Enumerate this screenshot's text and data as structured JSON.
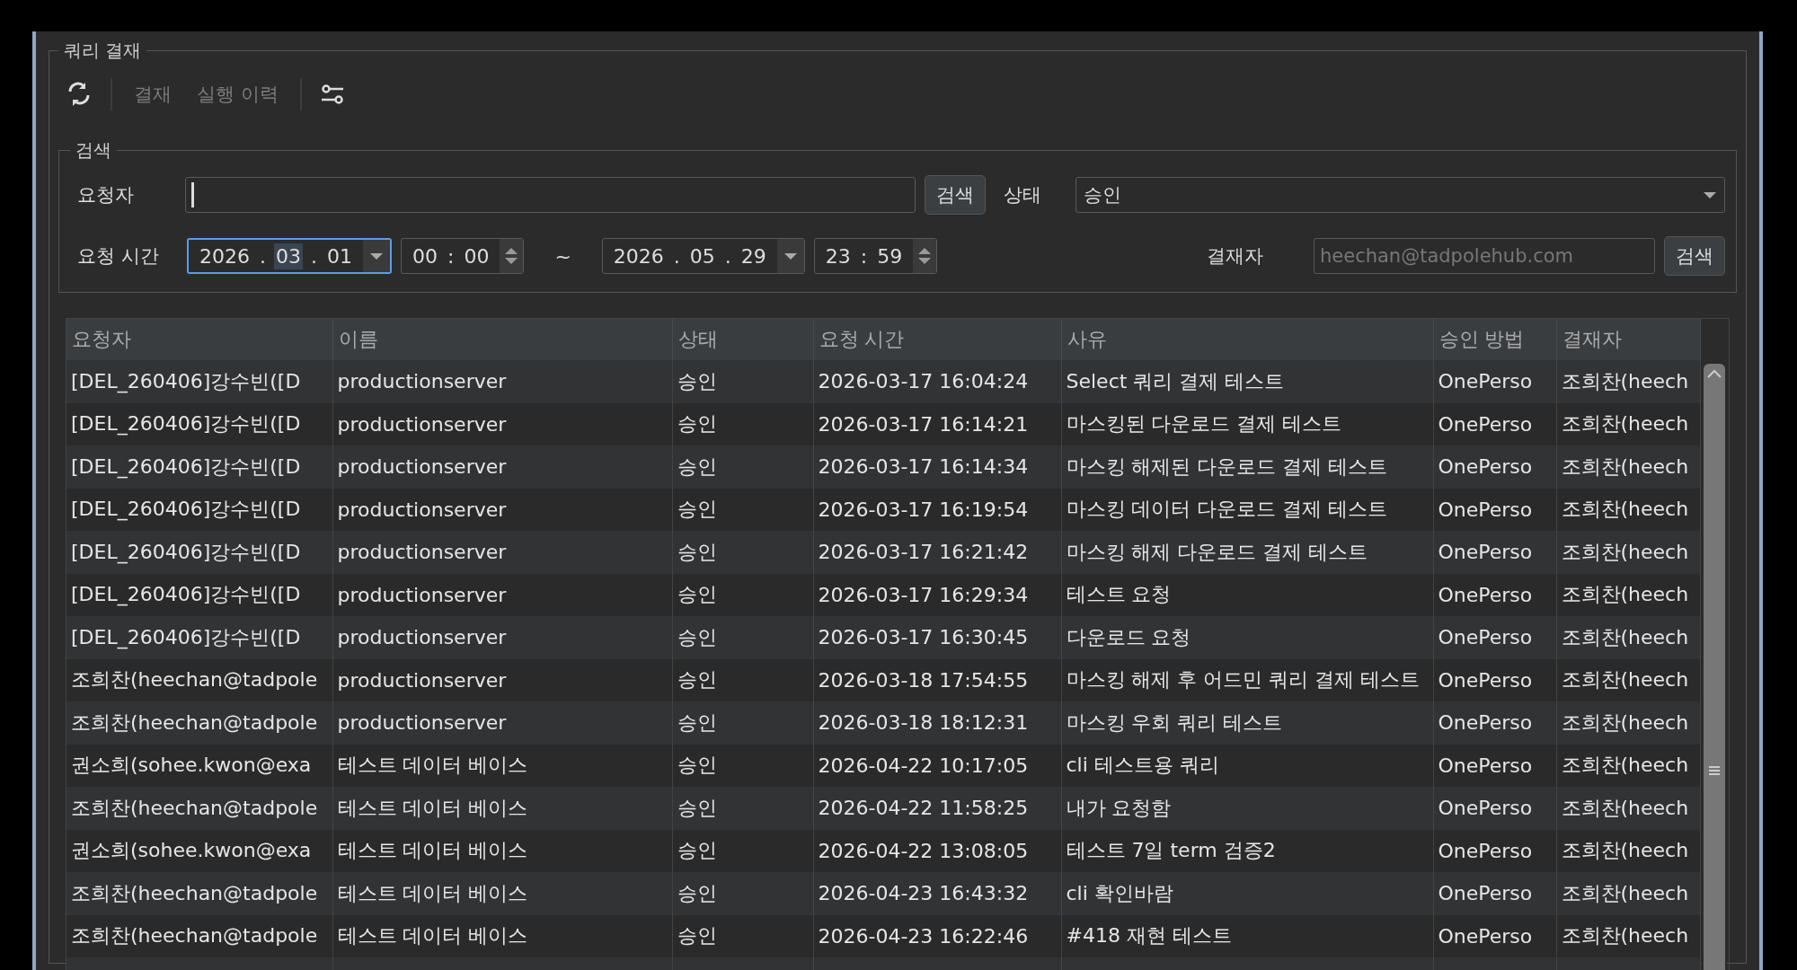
{
  "panel": {
    "title": "쿼리 결재"
  },
  "toolbar": [
    {
      "kind": "icon"
    },
    {
      "kind": "divider"
    },
    {
      "kind": "text",
      "label": "결재",
      "disabled": true
    },
    {
      "kind": "text",
      "label": "실행 이력",
      "disabled": true
    },
    {
      "kind": "divider"
    },
    {
      "kind": "icon"
    }
  ],
  "search": {
    "title": "검색",
    "requester": {
      "label": "요청자",
      "focused": true,
      "button": "검색"
    },
    "status": {
      "label": "상태",
      "value": "승인"
    },
    "time": {
      "label": "요청 시간",
      "separator_range": "~",
      "start_date": {
        "parts": [
          {
            "text": "2026",
            "selected": false
          },
          {
            "text": "03",
            "selected": true
          },
          {
            "text": "01",
            "selected": false
          }
        ],
        "separator": ".",
        "focused": true
      },
      "start_time": {
        "parts": [
          {
            "text": "00",
            "selected": false
          },
          {
            "text": "00",
            "selected": false
          }
        ],
        "separator": ":"
      },
      "end_date": {
        "parts": [
          {
            "text": "2026",
            "selected": false
          },
          {
            "text": "05",
            "selected": false
          },
          {
            "text": "29",
            "selected": false
          }
        ],
        "separator": ".",
        "focused": false
      },
      "end_time": {
        "parts": [
          {
            "text": "23",
            "selected": false
          },
          {
            "text": "59",
            "selected": false
          }
        ],
        "separator": ":"
      }
    },
    "approver": {
      "label": "결재자",
      "placeholder": "heechan@tadpolehub.com",
      "button": "검색"
    }
  },
  "table": {
    "columns": [
      "요청자",
      "이름",
      "상태",
      "요청 시간",
      "사유",
      "승인 방법",
      "결재자"
    ],
    "rows": [
      [
        "[DEL_260406]강수빈([D",
        "productionserver",
        "승인",
        "2026-03-17 16:04:24",
        "Select 쿼리 결제 테스트",
        "OnePerso",
        "조희찬(heech"
      ],
      [
        "[DEL_260406]강수빈([D",
        "productionserver",
        "승인",
        "2026-03-17 16:14:21",
        "마스킹된 다운로드 결제 테스트",
        "OnePerso",
        "조희찬(heech"
      ],
      [
        "[DEL_260406]강수빈([D",
        "productionserver",
        "승인",
        "2026-03-17 16:14:34",
        "마스킹 해제된 다운로드 결제 테스트",
        "OnePerso",
        "조희찬(heech"
      ],
      [
        "[DEL_260406]강수빈([D",
        "productionserver",
        "승인",
        "2026-03-17 16:19:54",
        "마스킹 데이터 다운로드 결제 테스트",
        "OnePerso",
        "조희찬(heech"
      ],
      [
        "[DEL_260406]강수빈([D",
        "productionserver",
        "승인",
        "2026-03-17 16:21:42",
        "마스킹 해제 다운로드 결제 테스트",
        "OnePerso",
        "조희찬(heech"
      ],
      [
        "[DEL_260406]강수빈([D",
        "productionserver",
        "승인",
        "2026-03-17 16:29:34",
        "테스트 요청",
        "OnePerso",
        "조희찬(heech"
      ],
      [
        "[DEL_260406]강수빈([D",
        "productionserver",
        "승인",
        "2026-03-17 16:30:45",
        "다운로드 요청",
        "OnePerso",
        "조희찬(heech"
      ],
      [
        "조희찬(heechan@tadpole",
        "productionserver",
        "승인",
        "2026-03-18 17:54:55",
        "마스킹 해제 후 어드민 쿼리 결제 테스트",
        "OnePerso",
        "조희찬(heech"
      ],
      [
        "조희찬(heechan@tadpole",
        "productionserver",
        "승인",
        "2026-03-18 18:12:31",
        "마스킹 우회 쿼리 테스트",
        "OnePerso",
        "조희찬(heech"
      ],
      [
        "권소희(sohee.kwon@exa",
        "테스트 데이터 베이스",
        "승인",
        "2026-04-22 10:17:05",
        "cli 테스트용 쿼리",
        "OnePerso",
        "조희찬(heech"
      ],
      [
        "조희찬(heechan@tadpole",
        "테스트 데이터 베이스",
        "승인",
        "2026-04-22 11:58:25",
        "내가 요청함",
        "OnePerso",
        "조희찬(heech"
      ],
      [
        "권소희(sohee.kwon@exa",
        "테스트 데이터 베이스",
        "승인",
        "2026-04-22 13:08:05",
        "테스트 7일 term 검증2",
        "OnePerso",
        "조희찬(heech"
      ],
      [
        "조희찬(heechan@tadpole",
        "테스트 데이터 베이스",
        "승인",
        "2026-04-23 16:43:32",
        "cli 확인바람",
        "OnePerso",
        "조희찬(heech"
      ],
      [
        "조희찬(heechan@tadpole",
        "테스트 데이터 베이스",
        "승인",
        "2026-04-23 16:22:46",
        "#418 재현 테스트",
        "OnePerso",
        "조희찬(heech"
      ]
    ]
  }
}
